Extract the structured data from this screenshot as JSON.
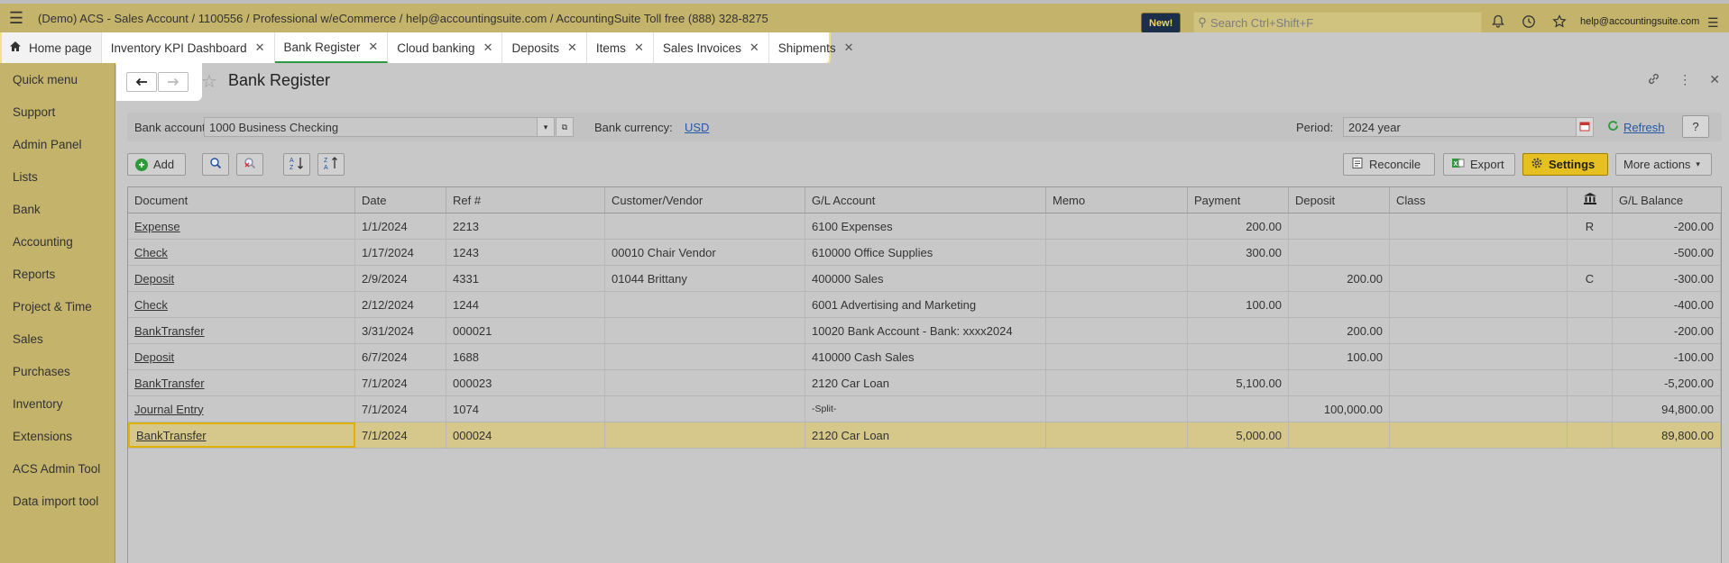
{
  "app": {
    "title": "(Demo) ACS - Sales Account / 1100556 / Professional w/eCommerce / help@accountingsuite.com / AccountingSuite Toll free (888) 328-8275",
    "new_badge": "New!",
    "search_placeholder": "Search Ctrl+Shift+F",
    "user_email": "help@accountingsuite.com"
  },
  "tabs": [
    {
      "label": "Home page"
    },
    {
      "label": "Inventory KPI Dashboard"
    },
    {
      "label": "Bank Register"
    },
    {
      "label": "Cloud banking"
    },
    {
      "label": "Deposits"
    },
    {
      "label": "Items"
    },
    {
      "label": "Sales Invoices"
    },
    {
      "label": "Shipments"
    }
  ],
  "sidebar": {
    "items": [
      {
        "label": "Quick menu"
      },
      {
        "label": "Support"
      },
      {
        "label": "Admin Panel"
      },
      {
        "label": "Lists"
      },
      {
        "label": "Bank"
      },
      {
        "label": "Accounting"
      },
      {
        "label": "Reports"
      },
      {
        "label": "Project & Time"
      },
      {
        "label": "Sales"
      },
      {
        "label": "Purchases"
      },
      {
        "label": "Inventory"
      },
      {
        "label": "Extensions"
      },
      {
        "label": "ACS Admin Tool"
      },
      {
        "label": "Data import tool"
      }
    ]
  },
  "page": {
    "title": "Bank Register"
  },
  "filters": {
    "bank_account_label": "Bank account:",
    "bank_account_value": "1000 Business Checking",
    "bank_currency_label": "Bank currency:",
    "bank_currency_value": "USD",
    "period_label": "Period:",
    "period_value": "2024 year",
    "refresh_label": "Refresh",
    "help_label": "?"
  },
  "toolbar": {
    "add_label": "Add",
    "reconcile_label": "Reconcile",
    "export_label": "Export",
    "settings_label": "Settings",
    "more_actions_label": "More actions"
  },
  "table": {
    "headers": {
      "document": "Document",
      "date": "Date",
      "ref": "Ref #",
      "customer": "Customer/Vendor",
      "gl_account": "G/L Account",
      "memo": "Memo",
      "payment": "Payment",
      "deposit": "Deposit",
      "class": "Class",
      "gl_balance": "G/L Balance"
    },
    "rows": [
      {
        "document": "Expense",
        "date": "1/1/2024",
        "ref": "2213",
        "customer": "",
        "gl_account": "6100 Expenses",
        "memo": "",
        "payment": "200.00",
        "deposit": "",
        "class": "",
        "reconciled": "R",
        "gl_balance": "-200.00"
      },
      {
        "document": "Check",
        "date": "1/17/2024",
        "ref": "1243",
        "customer": "00010 Chair Vendor",
        "gl_account": "610000 Office Supplies",
        "memo": "",
        "payment": "300.00",
        "deposit": "",
        "class": "",
        "reconciled": "",
        "gl_balance": "-500.00"
      },
      {
        "document": "Deposit",
        "date": "2/9/2024",
        "ref": "4331",
        "customer": "01044 Brittany",
        "gl_account": "400000 Sales",
        "memo": "",
        "payment": "",
        "deposit": "200.00",
        "class": "",
        "reconciled": "C",
        "gl_balance": "-300.00"
      },
      {
        "document": "Check",
        "date": "2/12/2024",
        "ref": "1244",
        "customer": "",
        "gl_account": "6001 Advertising and Marketing",
        "memo": "",
        "payment": "100.00",
        "deposit": "",
        "class": "",
        "reconciled": "",
        "gl_balance": "-400.00"
      },
      {
        "document": "BankTransfer",
        "date": "3/31/2024",
        "ref": "000021",
        "customer": "",
        "gl_account": "10020 Bank Account - Bank: xxxx2024",
        "memo": "",
        "payment": "",
        "deposit": "200.00",
        "class": "",
        "reconciled": "",
        "gl_balance": "-200.00"
      },
      {
        "document": "Deposit",
        "date": "6/7/2024",
        "ref": "1688",
        "customer": "",
        "gl_account": "410000 Cash Sales",
        "memo": "",
        "payment": "",
        "deposit": "100.00",
        "class": "",
        "reconciled": "",
        "gl_balance": "-100.00"
      },
      {
        "document": "BankTransfer",
        "date": "7/1/2024",
        "ref": "000023",
        "customer": "",
        "gl_account": "2120 Car Loan",
        "memo": "",
        "payment": "5,100.00",
        "deposit": "",
        "class": "",
        "reconciled": "",
        "gl_balance": "-5,200.00"
      },
      {
        "document": "Journal Entry",
        "date": "7/1/2024",
        "ref": "1074",
        "customer": "",
        "gl_account": "-Split-",
        "memo": "",
        "payment": "",
        "deposit": "100,000.00",
        "class": "",
        "reconciled": "",
        "gl_balance": "94,800.00"
      },
      {
        "document": "BankTransfer",
        "date": "7/1/2024",
        "ref": "000024",
        "customer": "",
        "gl_account": "2120 Car Loan",
        "memo": "",
        "payment": "5,000.00",
        "deposit": "",
        "class": "",
        "reconciled": "",
        "gl_balance": "89,800.00",
        "selected": true
      }
    ]
  }
}
